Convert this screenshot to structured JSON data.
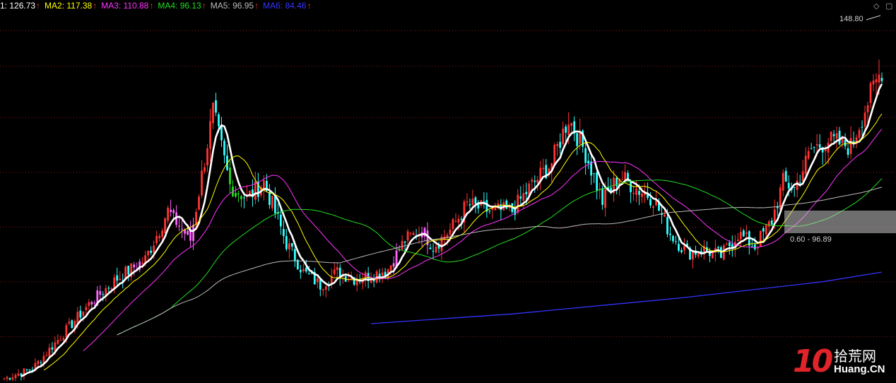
{
  "legend": [
    {
      "label": "1: 126.73",
      "color": "#ffffff",
      "arrow": "↑"
    },
    {
      "label": "MA2: 117.38",
      "color": "#ffff00",
      "arrow": "↑"
    },
    {
      "label": "MA3: 110.88",
      "color": "#ff33ff",
      "arrow": "↑"
    },
    {
      "label": "MA4: 96.13",
      "color": "#22dd22",
      "arrow": "↑"
    },
    {
      "label": "MA5: 96.95",
      "color": "#bbbbbb",
      "arrow": "↑"
    },
    {
      "label": "MA6: 84.46",
      "color": "#3333ff",
      "arrow": "↑"
    }
  ],
  "arrow_color": "#ff3333",
  "high_label": "148.80",
  "range_label": "0.60 - 96.89",
  "logo": {
    "number": "10",
    "cn": "拾荒网",
    "en": "Huang.CN"
  },
  "chart_data": {
    "type": "candlestick",
    "title": "",
    "xlabel": "",
    "ylabel": "",
    "ylim": [
      40,
      155
    ],
    "grid": true,
    "up_color": "#ff3333",
    "down_color": "#33ffff",
    "gridlines": [
      149,
      138,
      122,
      105,
      88,
      71,
      54
    ],
    "highlight_ranges": [
      {
        "x": [
          31,
          34
        ],
        "color": "#ff66ff"
      },
      {
        "x": [
          46,
          48
        ],
        "color": "#ff66ff"
      },
      {
        "x": [
          59,
          67
        ],
        "color": "#ff66ff"
      },
      {
        "x": [
          80,
          84
        ],
        "color": "#22dd22"
      },
      {
        "x": [
          138,
          140
        ],
        "color": "#ff66ff"
      },
      {
        "x": [
          148,
          150
        ],
        "color": "#ff66ff"
      }
    ],
    "anchor_closes": [
      [
        0,
        41
      ],
      [
        10,
        44
      ],
      [
        20,
        54
      ],
      [
        30,
        64
      ],
      [
        40,
        72
      ],
      [
        50,
        78
      ],
      [
        58,
        93
      ],
      [
        66,
        84
      ],
      [
        74,
        124
      ],
      [
        80,
        101
      ],
      [
        86,
        97
      ],
      [
        92,
        102
      ],
      [
        100,
        83
      ],
      [
        106,
        74
      ],
      [
        112,
        70
      ],
      [
        118,
        74
      ],
      [
        124,
        72
      ],
      [
        130,
        73
      ],
      [
        136,
        75
      ],
      [
        142,
        84
      ],
      [
        148,
        87
      ],
      [
        152,
        82
      ],
      [
        158,
        87
      ],
      [
        164,
        95
      ],
      [
        172,
        93
      ],
      [
        180,
        93
      ],
      [
        186,
        100
      ],
      [
        194,
        108
      ],
      [
        200,
        122
      ],
      [
        206,
        111
      ],
      [
        212,
        96
      ],
      [
        218,
        104
      ],
      [
        224,
        100
      ],
      [
        230,
        97
      ],
      [
        236,
        86
      ],
      [
        242,
        80
      ],
      [
        248,
        81
      ],
      [
        254,
        79
      ],
      [
        260,
        86
      ],
      [
        266,
        82
      ],
      [
        272,
        90
      ],
      [
        276,
        102
      ],
      [
        280,
        100
      ],
      [
        286,
        112
      ],
      [
        292,
        115
      ],
      [
        300,
        113
      ],
      [
        306,
        127
      ],
      [
        311,
        137
      ]
    ],
    "ma_series": [
      {
        "name": "1",
        "color": "#ffffff",
        "width": 2.6,
        "period": 6
      },
      {
        "name": "MA2",
        "color": "#ffff00",
        "width": 1,
        "period": 14
      },
      {
        "name": "MA3",
        "color": "#ff33ff",
        "width": 1,
        "period": 28
      },
      {
        "name": "MA4",
        "color": "#22dd22",
        "width": 1,
        "period": 60
      },
      {
        "name": "MA5",
        "color": "#bbbbbb",
        "width": 1,
        "period": 120
      },
      {
        "name": "MA6",
        "color": "#3333ff",
        "width": 1.3,
        "period": 240
      }
    ],
    "ma6_path": [
      [
        130,
        58
      ],
      [
        180,
        61
      ],
      [
        240,
        66
      ],
      [
        290,
        71
      ],
      [
        311,
        74
      ]
    ]
  }
}
